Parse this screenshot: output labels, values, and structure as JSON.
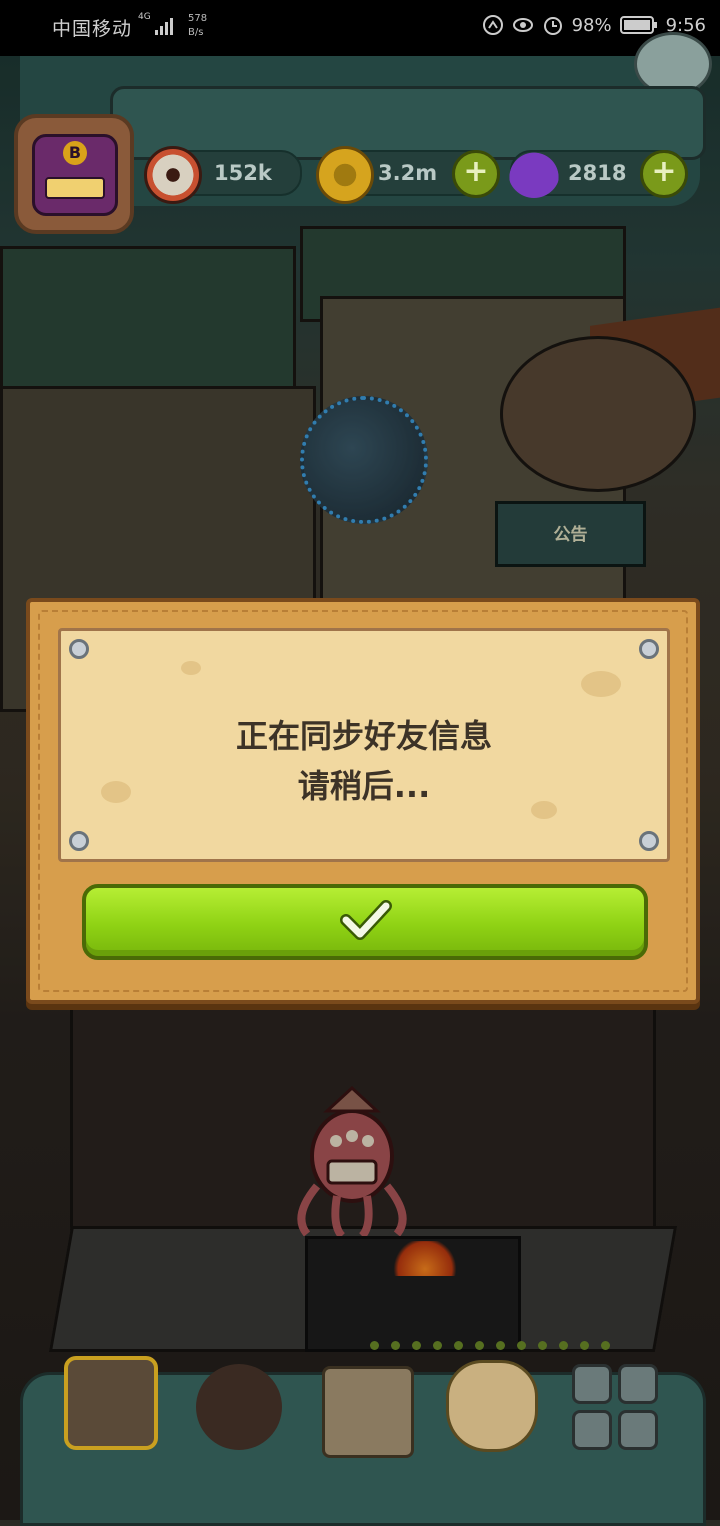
{
  "status_bar": {
    "carrier": "中国移动",
    "network": "4G",
    "speed_top": "578",
    "speed_bottom": "B/s",
    "battery": "98%",
    "time": "9:56"
  },
  "resources": {
    "eyeballs": "152k",
    "coins": "3.2m",
    "potions": "2818",
    "add_symbol": "+"
  },
  "avatar": {
    "rank_letter": "B"
  },
  "world": {
    "notice_board": "公告"
  },
  "dialog": {
    "line1": "正在同步好友信息",
    "line2": "请稍后..."
  },
  "bottom_nav": {
    "items": [
      "restaurant",
      "monster",
      "recipe-book",
      "money-bag",
      "more"
    ]
  },
  "colors": {
    "dialog_wood": "#d79e4c",
    "parchment": "#f1d8a0",
    "confirm_green": "#8fd214",
    "hud_teal": "#2f5550"
  }
}
